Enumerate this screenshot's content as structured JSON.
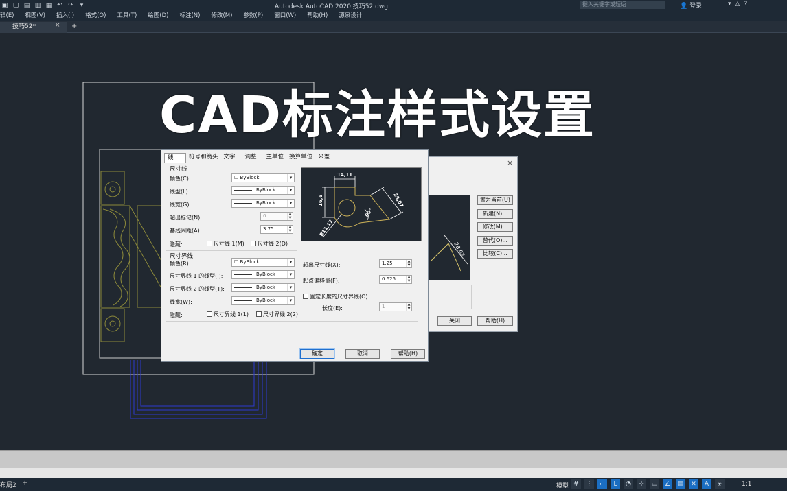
{
  "titlebar": {
    "title": "Autodesk AutoCAD 2020    技巧52.dwg",
    "search_placeholder": "键入关键字或短语",
    "login": "登录"
  },
  "menu": [
    "辑(E)",
    "视图(V)",
    "插入(I)",
    "格式(O)",
    "工具(T)",
    "绘图(D)",
    "标注(N)",
    "修改(M)",
    "参数(P)",
    "窗口(W)",
    "帮助(H)",
    "源泉设计"
  ],
  "tabs": {
    "active": "技巧52*",
    "close": "×",
    "add": "+"
  },
  "headline": "CAD标注样式设置",
  "dialog": {
    "tabs": [
      "线",
      "符号和箭头",
      "文字",
      "调整",
      "主单位",
      "换算单位",
      "公差"
    ],
    "dim_lines": {
      "title": "尺寸线",
      "color_label": "颜色(C):",
      "color_value": "ByBlock",
      "linetype_label": "线型(L):",
      "linetype_value": "ByBlock",
      "lineweight_label": "线宽(G):",
      "lineweight_value": "ByBlock",
      "extend_label": "超出标记(N):",
      "extend_value": "0",
      "baseline_label": "基线间距(A):",
      "baseline_value": "3.75",
      "suppress_label": "隐藏:",
      "suppress1": "尺寸线 1(M)",
      "suppress2": "尺寸线 2(D)"
    },
    "ext_lines": {
      "title": "尺寸界线",
      "color_label": "颜色(R):",
      "color_value": "ByBlock",
      "lt1_label": "尺寸界线 1 的线型(I):",
      "lt1_value": "ByBlock",
      "lt2_label": "尺寸界线 2 的线型(T):",
      "lt2_value": "ByBlock",
      "lineweight_label": "线宽(W):",
      "lineweight_value": "ByBlock",
      "suppress_label": "隐藏:",
      "suppress1": "尺寸界线 1(1)",
      "suppress2": "尺寸界线 2(2)",
      "beyond_label": "超出尺寸线(X):",
      "beyond_value": "1.25",
      "offset_label": "起点偏移量(F):",
      "offset_value": "0.625",
      "fixed_label": "固定长度的尺寸界线(O)",
      "length_label": "长度(E):",
      "length_value": "1"
    },
    "preview_dims": [
      "14,11",
      "16,6",
      "28,07",
      "R11,17",
      "60°"
    ],
    "buttons": {
      "ok": "确定",
      "cancel": "取消",
      "help": "帮助(H)"
    }
  },
  "back_dialog": {
    "close": "×",
    "buttons": [
      "置为当前(U)",
      "新建(N)...",
      "修改(M)...",
      "替代(O)...",
      "比较(C)..."
    ],
    "close_button": "关闭",
    "help_button": "帮助(H)",
    "preview_dim": "28,07"
  },
  "status": {
    "layout": "布局2",
    "layout_add": "+",
    "model": "模型",
    "scale": "1:1"
  }
}
